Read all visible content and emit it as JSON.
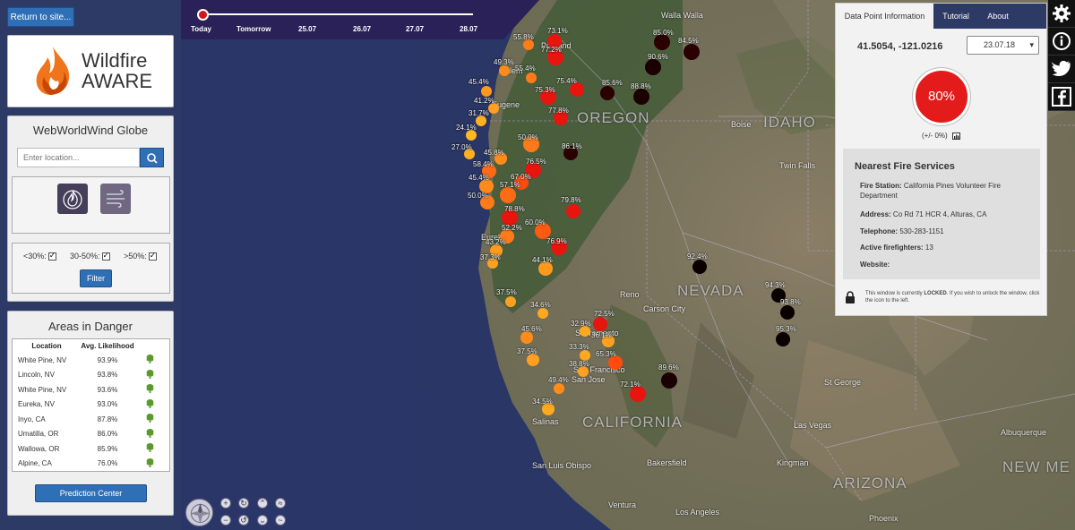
{
  "left": {
    "return_label": "Return to site...",
    "logo_line1": "Wildfire",
    "logo_line2": "AWARE",
    "globe_title": "WebWorldWind Globe",
    "search_placeholder": "Enter location...",
    "filters": [
      {
        "label": "<30%:",
        "checked": true
      },
      {
        "label": "30-50%:",
        "checked": true
      },
      {
        "label": ">50%:",
        "checked": true
      }
    ],
    "filter_label": "Filter",
    "danger_title": "Areas in Danger",
    "danger_cols": [
      "Location",
      "Avg. Likelihood"
    ],
    "danger_rows": [
      {
        "loc": "White Pine, NV",
        "pct": "93.9%"
      },
      {
        "loc": "Lincoln, NV",
        "pct": "93.8%"
      },
      {
        "loc": "White Pine, NV",
        "pct": "93.6%"
      },
      {
        "loc": "Eureka, NV",
        "pct": "93.0%"
      },
      {
        "loc": "Inyo, CA",
        "pct": "87.8%"
      },
      {
        "loc": "Umatilla, OR",
        "pct": "86.0%"
      },
      {
        "loc": "Wallowa, OR",
        "pct": "85.9%"
      },
      {
        "loc": "Alpine, CA",
        "pct": "76.0%"
      }
    ],
    "prediction_label": "Prediction Center"
  },
  "timeline": {
    "labels": [
      "Today",
      "Tomorrow",
      "25.07",
      "26.07",
      "27.07",
      "28.07"
    ],
    "position": 0
  },
  "map": {
    "place_labels": [
      {
        "t": "Walla Walla"
      },
      {
        "t": "Boise"
      },
      {
        "t": "Twin Falls"
      },
      {
        "t": "Eugene"
      },
      {
        "t": "Salem"
      },
      {
        "t": "Portland"
      },
      {
        "t": "Eureka"
      },
      {
        "t": "Reno"
      },
      {
        "t": "Carson City"
      },
      {
        "t": "Sacramento"
      },
      {
        "t": "San Francisco"
      },
      {
        "t": "San Jose"
      },
      {
        "t": "Salinas"
      },
      {
        "t": "Bakersfield"
      },
      {
        "t": "San Luis Obispo"
      },
      {
        "t": "Ventura"
      },
      {
        "t": "Los Angeles"
      },
      {
        "t": "Las Vegas"
      },
      {
        "t": "Kingman"
      },
      {
        "t": "St George"
      },
      {
        "t": "Phoenix"
      },
      {
        "t": "Albuquerque"
      }
    ],
    "region_labels": [
      {
        "t": "OREGON"
      },
      {
        "t": "IDAHO"
      },
      {
        "t": "NEVADA"
      },
      {
        "t": "CALIFORNIA"
      },
      {
        "t": "ARIZONA"
      },
      {
        "t": "NEW ME"
      }
    ],
    "points": [
      {
        "v": "73.1%",
        "c": "#e8140e"
      },
      {
        "v": "55.8%",
        "c": "#ff7a18"
      },
      {
        "v": "77.2%",
        "c": "#e8140e"
      },
      {
        "v": "49.3%",
        "c": "#ff8c1a"
      },
      {
        "v": "55.4%",
        "c": "#ff7a18"
      },
      {
        "v": "45.4%",
        "c": "#ff9a1e"
      },
      {
        "v": "75.4%",
        "c": "#e8140e"
      },
      {
        "v": "75.3%",
        "c": "#e8140e"
      },
      {
        "v": "41.2%",
        "c": "#ffa020"
      },
      {
        "v": "77.8%",
        "c": "#e8140e"
      },
      {
        "v": "31.7%",
        "c": "#ffb020"
      },
      {
        "v": "24.1%",
        "c": "#ffb820"
      },
      {
        "v": "50.0%",
        "c": "#ff7a18"
      },
      {
        "v": "86.1%",
        "c": "#2a0000"
      },
      {
        "v": "27.0%",
        "c": "#ffb020"
      },
      {
        "v": "45.8%",
        "c": "#ff8c1a"
      },
      {
        "v": "58.4%",
        "c": "#ff6a14"
      },
      {
        "v": "76.5%",
        "c": "#e8140e"
      },
      {
        "v": "45.4%",
        "c": "#ff8c1a"
      },
      {
        "v": "67.0%",
        "c": "#ff4a10"
      },
      {
        "v": "57.1%",
        "c": "#ff6a14"
      },
      {
        "v": "50.0%",
        "c": "#ff7a18"
      },
      {
        "v": "79.8%",
        "c": "#e8140e"
      },
      {
        "v": "78.8%",
        "c": "#e8140e"
      },
      {
        "v": "60.0%",
        "c": "#ff5a12"
      },
      {
        "v": "52.2%",
        "c": "#ff7a18"
      },
      {
        "v": "76.9%",
        "c": "#e8140e"
      },
      {
        "v": "43.2%",
        "c": "#ff9a1e"
      },
      {
        "v": "37.3%",
        "c": "#ffa020"
      },
      {
        "v": "44.1%",
        "c": "#ff9a1e"
      },
      {
        "v": "37.5%",
        "c": "#ffa020"
      },
      {
        "v": "34.6%",
        "c": "#ffa820"
      },
      {
        "v": "72.5%",
        "c": "#e8140e"
      },
      {
        "v": "32.9%",
        "c": "#ffa820"
      },
      {
        "v": "45.6%",
        "c": "#ff8c1a"
      },
      {
        "v": "36.1%",
        "c": "#ffa020"
      },
      {
        "v": "33.3%",
        "c": "#ffa820"
      },
      {
        "v": "37.5%",
        "c": "#ffa020"
      },
      {
        "v": "38.8%",
        "c": "#ffa020"
      },
      {
        "v": "65.3%",
        "c": "#ff4a10"
      },
      {
        "v": "49.4%",
        "c": "#ff8c1a"
      },
      {
        "v": "34.5%",
        "c": "#ffa820"
      },
      {
        "v": "72.1%",
        "c": "#e8140e"
      },
      {
        "v": "89.6%",
        "c": "#1a0000"
      },
      {
        "v": "85.0%",
        "c": "#2a0000"
      },
      {
        "v": "84.5%",
        "c": "#2a0000"
      },
      {
        "v": "90.6%",
        "c": "#1a0000"
      },
      {
        "v": "85.6%",
        "c": "#2a0000"
      },
      {
        "v": "88.8%",
        "c": "#1a0000"
      },
      {
        "v": "92.4%",
        "c": "#0a0000"
      },
      {
        "v": "94.3%",
        "c": "#0a0000"
      },
      {
        "v": "93.8%",
        "c": "#0a0000"
      },
      {
        "v": "95.3%",
        "c": "#0a0000"
      }
    ]
  },
  "info": {
    "tabs": [
      "Data Point Information",
      "Tutorial",
      "About"
    ],
    "coords": "41.5054, -121.0216",
    "date": "23.07.18",
    "percent": "80%",
    "variance": "(+/- 0%)",
    "fire_title": "Nearest Fire Services",
    "fields": [
      {
        "k": "Fire Station:",
        "v": "California Pines Volunteer Fire Department"
      },
      {
        "k": "Address:",
        "v": "Co Rd 71 HCR 4, Alturas, CA"
      },
      {
        "k": "Telephone:",
        "v": "530-283-1151"
      },
      {
        "k": "Active firefighters:",
        "v": "13"
      },
      {
        "k": "Website:",
        "v": ""
      }
    ],
    "lock_note_pre": "This window is currently ",
    "lock_note_bold": "LOCKED",
    "lock_note_post": ". If you wish to unlock the window, click the icon to the left."
  },
  "social": [
    "gear-icon",
    "info-icon",
    "twitter-icon",
    "facebook-icon"
  ]
}
